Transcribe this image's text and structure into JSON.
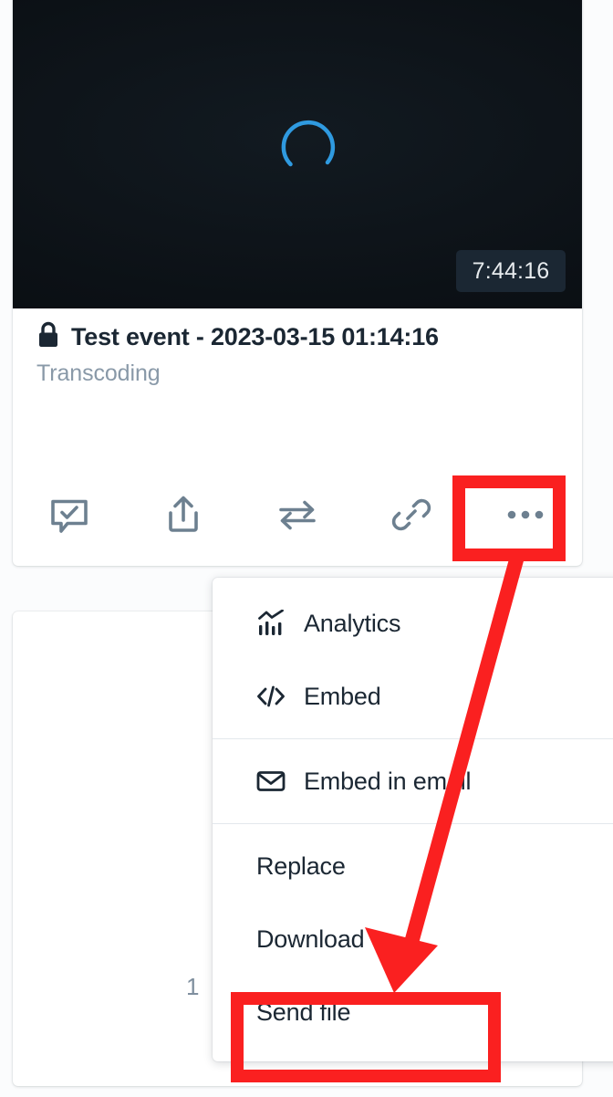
{
  "asset": {
    "privacy_icon": "lock-icon",
    "title": "Test event - 2023-03-15 01:14:16",
    "status": "Transcoding",
    "duration": "7:44:16",
    "player_state_icon": "loading-spinner-icon"
  },
  "toolbar": {
    "items": [
      {
        "name": "comment-approve",
        "icon": "comment-check-icon"
      },
      {
        "name": "share",
        "icon": "share-upload-icon"
      },
      {
        "name": "transfer",
        "icon": "transfer-arrows-icon"
      },
      {
        "name": "copy-link",
        "icon": "link-icon"
      },
      {
        "name": "more-options",
        "icon": "more-horizontal-icon"
      }
    ]
  },
  "menu": {
    "groups": [
      {
        "items": [
          {
            "label": "Analytics",
            "icon": "analytics-chart-icon"
          },
          {
            "label": "Embed",
            "icon": "code-brackets-icon"
          }
        ]
      },
      {
        "items": [
          {
            "label": "Embed in email",
            "icon": "envelope-icon"
          }
        ]
      },
      {
        "items": [
          {
            "label": "Replace",
            "icon": ""
          },
          {
            "label": "Download",
            "icon": ""
          },
          {
            "label": "Send file",
            "icon": ""
          }
        ]
      }
    ]
  },
  "background_card": {
    "number": "1"
  },
  "annotations": {
    "color": "#fa2020",
    "highlight_more_button": "more-options",
    "highlight_menu_item": "Send file",
    "arrow": "points from the more-options button down to the Send file menu item"
  },
  "colors": {
    "accent_blue": "#2f9ae0",
    "text_dark": "#1b2733",
    "text_muted": "#8999a8",
    "icon_slate": "#6d8090",
    "annotation_red": "#fa2020",
    "badge_bg": "#1b2733",
    "divider": "#e3e8ec"
  }
}
